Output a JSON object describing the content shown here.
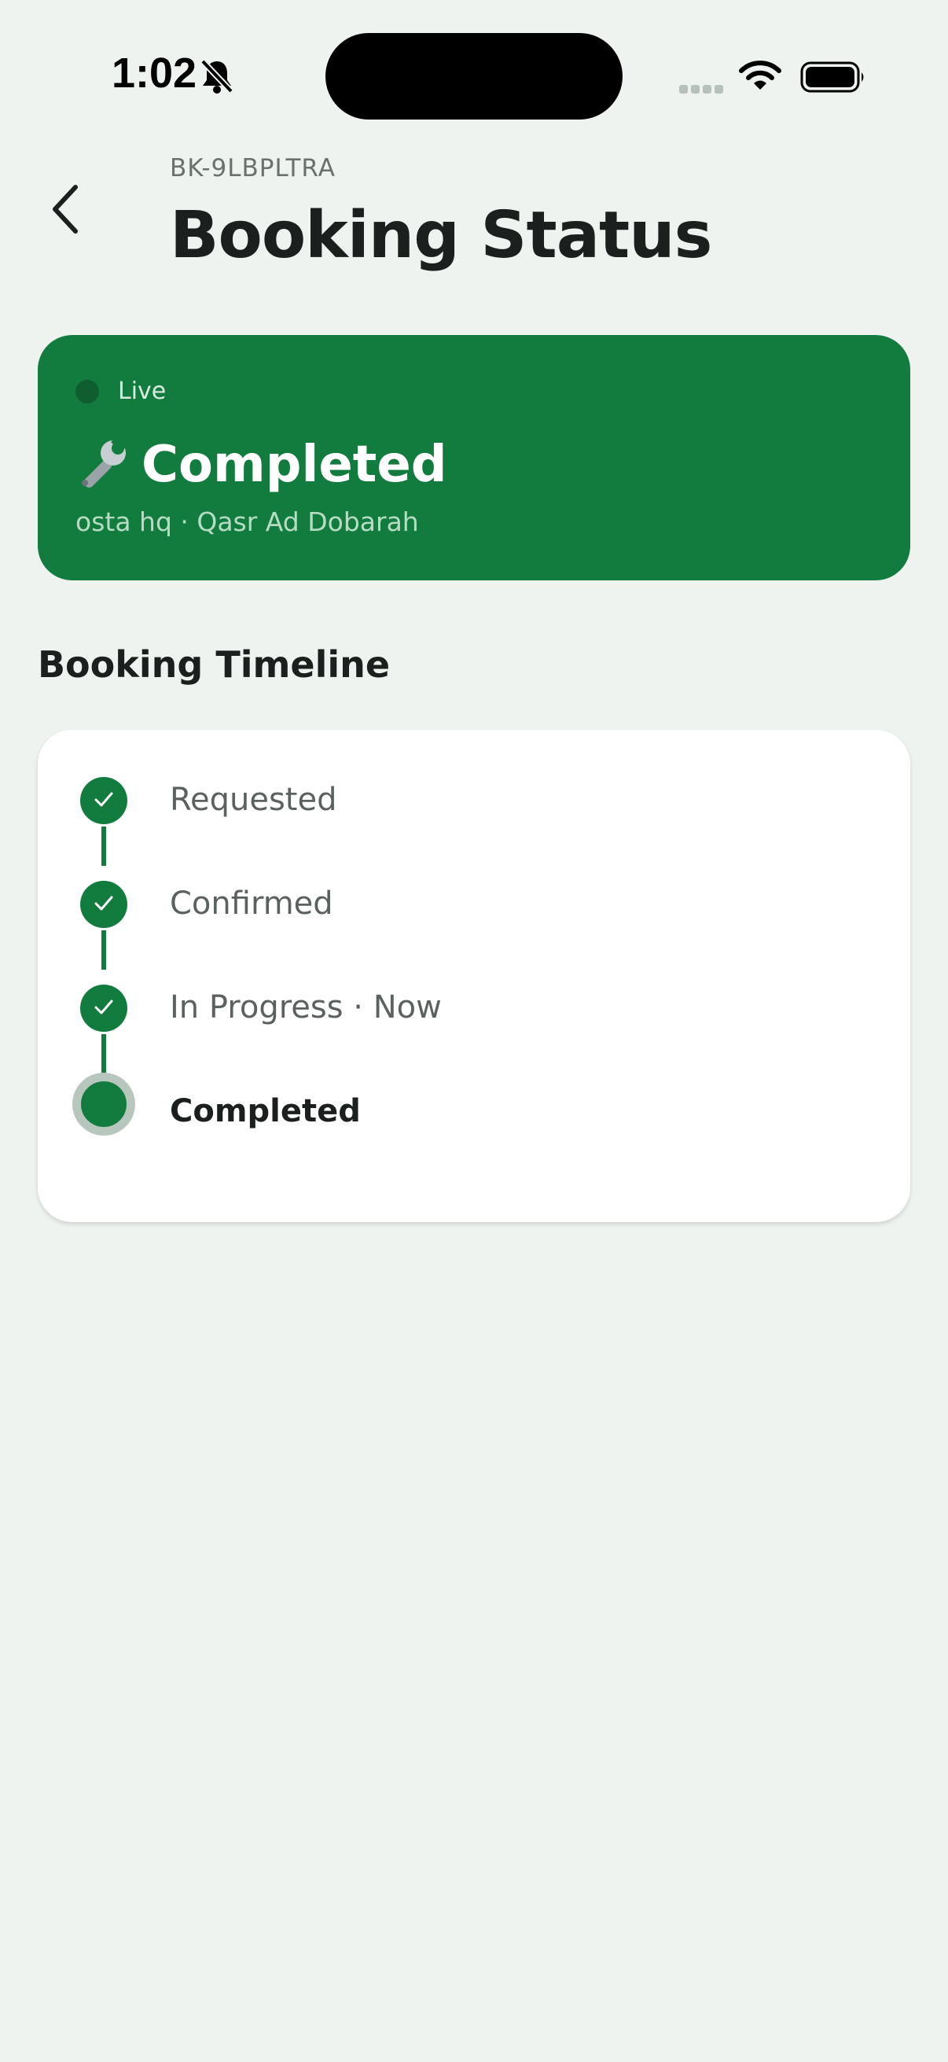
{
  "status_bar": {
    "time": "1:02",
    "icons": [
      "bell-slash-icon",
      "cellular-signal-icon",
      "wifi-icon",
      "battery-icon"
    ]
  },
  "header": {
    "booking_id": "BK-9LBPLTRA",
    "title": "Booking Status",
    "back_icon": "chevron-left-icon"
  },
  "status_card": {
    "live_label": "Live",
    "icon": "wrench-icon",
    "status": "Completed",
    "subtitle": "osta hq · Qasr Ad Dobarah",
    "color": "#127b3e"
  },
  "timeline": {
    "heading": "Booking Timeline",
    "steps": [
      {
        "label": "Requested",
        "done": true
      },
      {
        "label": "Confirmed",
        "done": true
      },
      {
        "label": "In Progress · Now",
        "done": true
      },
      {
        "label": "Completed",
        "done": false,
        "current": true
      }
    ]
  }
}
